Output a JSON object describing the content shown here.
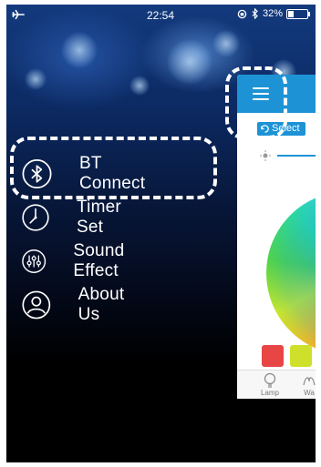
{
  "status_bar": {
    "time": "22:54",
    "battery_percent": "32%",
    "battery_level": 0.32
  },
  "menu": {
    "items": [
      {
        "label": "BT Connect",
        "icon": "bluetooth-icon"
      },
      {
        "label": "Timer Set",
        "icon": "timer-icon"
      },
      {
        "label": "Sound Effect",
        "icon": "equalizer-icon"
      },
      {
        "label": "About Us",
        "icon": "user-icon"
      }
    ]
  },
  "panel": {
    "select_label": "Select",
    "tabs": [
      {
        "label": "Lamp",
        "icon": "lamp-icon"
      },
      {
        "label": "Wa",
        "icon": "wave-icon"
      }
    ],
    "swatches": [
      "#e84545",
      "#cfe02a",
      "#22cc44"
    ]
  },
  "colors": {
    "accent": "#1d93d6",
    "highlight": "#ffffff"
  }
}
